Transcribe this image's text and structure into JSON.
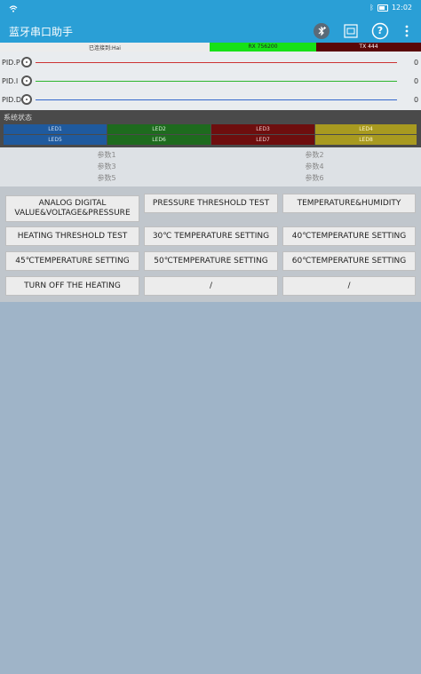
{
  "status_bar": {
    "time": "12:02"
  },
  "app_bar": {
    "title": "蓝牙串口助手",
    "help_icon_label": "?"
  },
  "connection": {
    "status": "已连接到:Hai",
    "rx": "RX 756200",
    "tx": "TX 444"
  },
  "pid": [
    {
      "label": "PID.P",
      "value": "0",
      "color": "#cc3333"
    },
    {
      "label": "PID.I",
      "value": "0",
      "color": "#2db52d"
    },
    {
      "label": "PID.D",
      "value": "0",
      "color": "#3366cc"
    }
  ],
  "system_state": {
    "title": "系统状态",
    "leds": [
      {
        "label": "LED1",
        "color": "#1f5a9e"
      },
      {
        "label": "LED2",
        "color": "#1e6b1e"
      },
      {
        "label": "LED3",
        "color": "#6e0e0e"
      },
      {
        "label": "LED4",
        "color": "#a89a20"
      },
      {
        "label": "LED5",
        "color": "#1f5a9e"
      },
      {
        "label": "LED6",
        "color": "#1e6b1e"
      },
      {
        "label": "LED7",
        "color": "#6e0e0e"
      },
      {
        "label": "LED8",
        "color": "#a89a20"
      }
    ]
  },
  "params": [
    "参数1",
    "参数2",
    "参数3",
    "参数4",
    "参数5",
    "参数6"
  ],
  "buttons": [
    "ANALOG DIGITAL VALUE&VOLTAGE&PRESSURE",
    "PRESSURE THRESHOLD TEST",
    "TEMPERATURE&HUMIDITY",
    "HEATING THRESHOLD TEST",
    "30℃ TEMPERATURE SETTING",
    "40℃TEMPERATURE SETTING",
    "45℃TEMPERATURE SETTING",
    "50℃TEMPERATURE SETTING",
    "60℃TEMPERATURE SETTING",
    "TURN OFF THE HEATING",
    "/",
    "/"
  ]
}
